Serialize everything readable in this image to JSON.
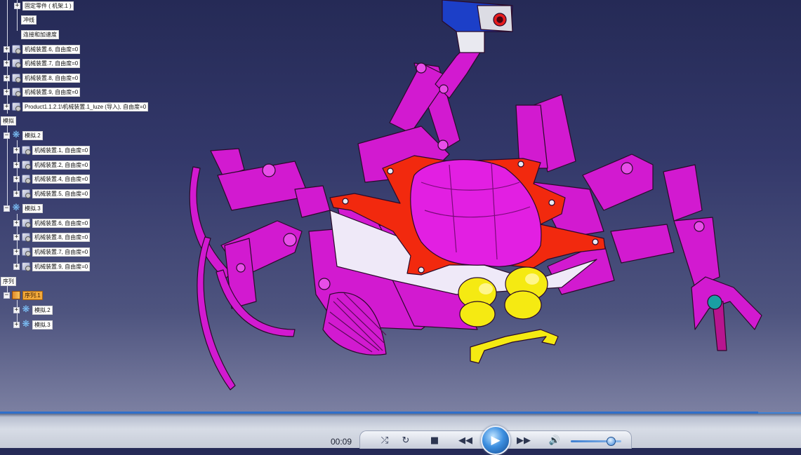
{
  "tree": {
    "top_items": [
      {
        "label": "固定零件 ( 机架.1 )"
      },
      {
        "label": "冲线"
      },
      {
        "label": "连接和加速度"
      },
      {
        "label": "机械装置.6, 自由度=0"
      },
      {
        "label": "机械装置.7, 自由度=0"
      },
      {
        "label": "机械装置.8, 自由度=0"
      },
      {
        "label": "机械装置.9, 自由度=0"
      },
      {
        "label": "Product1.1.2.1\\机械装置.1_luze (导入), 自由度=0"
      }
    ],
    "sim_section": {
      "label": "模拟"
    },
    "sim2": {
      "label": "模拟.2",
      "children": [
        {
          "label": "机械装置.1, 自由度=0"
        },
        {
          "label": "机械装置.2, 自由度=0"
        },
        {
          "label": "机械装置.4, 自由度=0"
        },
        {
          "label": "机械装置.5, 自由度=0"
        }
      ]
    },
    "sim3": {
      "label": "模拟.3",
      "children": [
        {
          "label": "机械装置.6, 自由度=0"
        },
        {
          "label": "机械装置.8, 自由度=0"
        },
        {
          "label": "机械装置.7, 自由度=0"
        },
        {
          "label": "机械装置.9, 自由度=0"
        }
      ]
    },
    "seq_section": {
      "label": "序列"
    },
    "seq1": {
      "label": "序列.1"
    },
    "seq_children": [
      {
        "label": "模拟.2"
      },
      {
        "label": "模拟.3"
      }
    ]
  },
  "player": {
    "time": "00:09",
    "volume_level": 0.8,
    "icons": [
      "shuffle-icon",
      "repeat-icon",
      "stop-icon",
      "rewind-icon",
      "play-icon",
      "fast-forward-icon",
      "volume-icon"
    ]
  },
  "colors": {
    "body": "#e11fe0",
    "plate": "#f2290e",
    "yellow": "#f5ea12",
    "camera": "#1c3fc8"
  }
}
